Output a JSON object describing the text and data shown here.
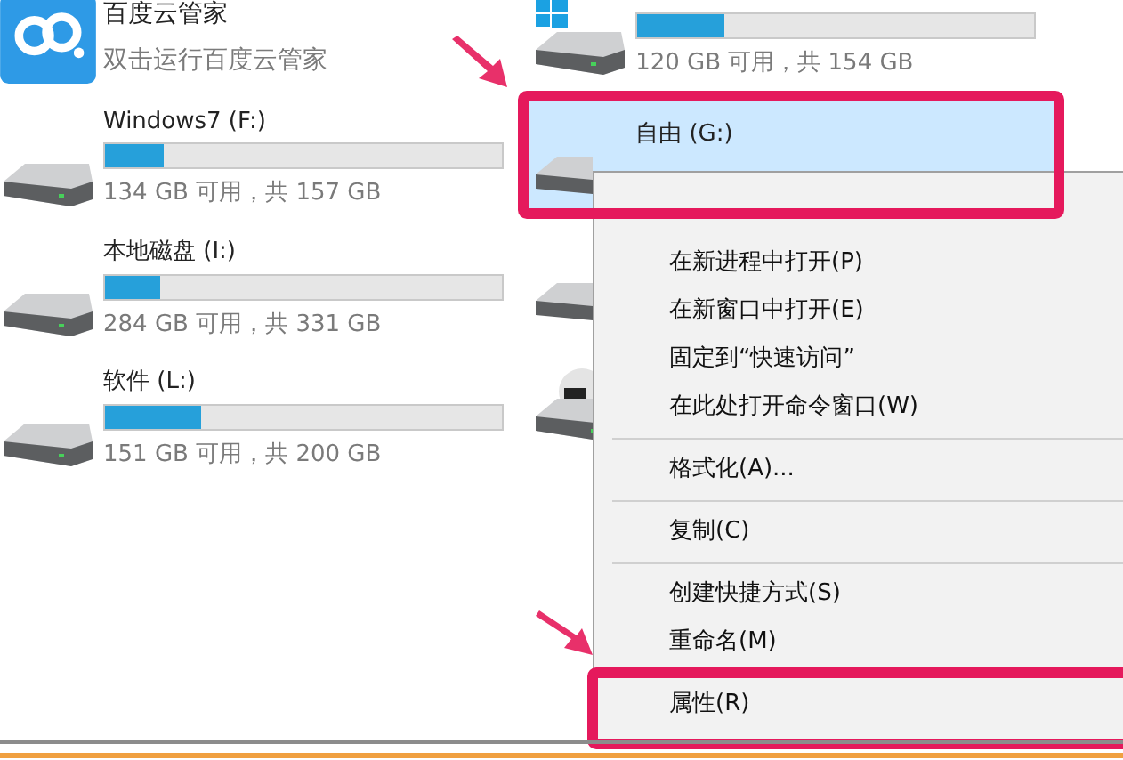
{
  "left_items": [
    {
      "kind": "app",
      "name": "百度云管家",
      "detail": "双击运行百度云管家"
    },
    {
      "kind": "drive",
      "name": "Windows7 (F:)",
      "level": 0.15,
      "detail": "134 GB 可用，共 157 GB"
    },
    {
      "kind": "drive",
      "name": "本地磁盘 (I:)",
      "level": 0.14,
      "detail": "284 GB 可用，共 331 GB"
    },
    {
      "kind": "drive",
      "name": "软件 (L:)",
      "level": 0.24,
      "detail": "151 GB 可用，共 200 GB"
    }
  ],
  "right_items": [
    {
      "kind": "system",
      "level": 0.22,
      "detail": "120 GB 可用，共 154 GB",
      "selected": false
    },
    {
      "kind": "drive",
      "name": "自由 (G:)",
      "selected": true
    },
    {
      "kind": "drive",
      "selected": false
    },
    {
      "kind": "dvd",
      "selected": false
    }
  ],
  "context_menu": [
    {
      "kind": "item",
      "label": "在新进程中打开(P)"
    },
    {
      "kind": "item",
      "label": "在新窗口中打开(E)"
    },
    {
      "kind": "item",
      "label": "固定到“快速访问”"
    },
    {
      "kind": "item",
      "label": "在此处打开命令窗口(W)"
    },
    {
      "kind": "separator"
    },
    {
      "kind": "item",
      "label": "格式化(A)..."
    },
    {
      "kind": "separator"
    },
    {
      "kind": "item",
      "label": "复制(C)"
    },
    {
      "kind": "separator"
    },
    {
      "kind": "item",
      "label": "创建快捷方式(S)"
    },
    {
      "kind": "item",
      "label": "重命名(M)"
    },
    {
      "kind": "item",
      "label": "属性(R)"
    }
  ]
}
